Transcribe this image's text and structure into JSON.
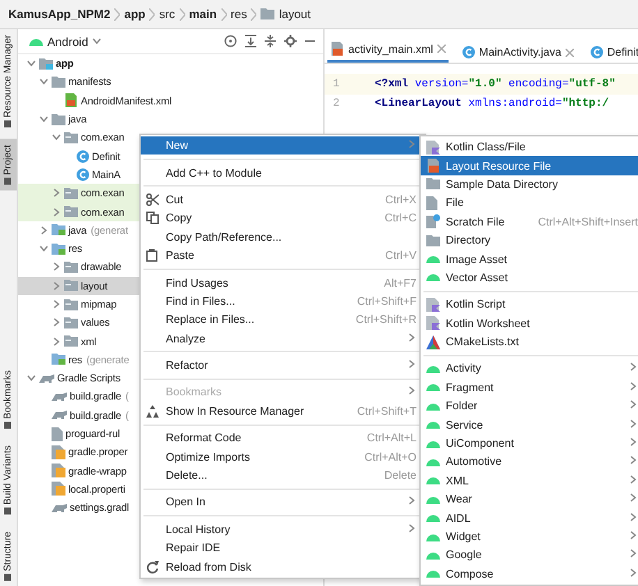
{
  "breadcrumb": [
    {
      "label": "KamusApp_NPM2",
      "bold": true,
      "kind": "plain"
    },
    {
      "label": "app",
      "bold": true,
      "kind": "plain"
    },
    {
      "label": "src",
      "bold": false,
      "kind": "plain"
    },
    {
      "label": "main",
      "bold": true,
      "kind": "plain"
    },
    {
      "label": "res",
      "bold": false,
      "kind": "plain"
    },
    {
      "label": "layout",
      "bold": false,
      "kind": "folder"
    }
  ],
  "tool_strip": {
    "top": [
      {
        "label": "Resource Manager",
        "selected": false
      },
      {
        "label": "Project",
        "selected": true
      }
    ],
    "bottom": [
      {
        "label": "Bookmarks",
        "selected": false
      },
      {
        "label": "Build Variants",
        "selected": false
      },
      {
        "label": "Structure",
        "selected": false
      }
    ]
  },
  "project_panel": {
    "view_selector": "Android",
    "tree": [
      {
        "label": "app",
        "kind": "module",
        "bold": true,
        "expanded": true,
        "selected": false,
        "test_source": false,
        "children": [
          {
            "label": "manifests",
            "kind": "folder",
            "expanded": true,
            "selected": false,
            "test_source": false,
            "children": [
              {
                "label": "AndroidManifest.xml",
                "kind": "manifest",
                "selected": false,
                "test_source": false
              }
            ]
          },
          {
            "label": "java",
            "kind": "folder",
            "expanded": true,
            "selected": false,
            "test_source": false,
            "children": [
              {
                "label": "com.exan",
                "kind": "package",
                "expanded": true,
                "selected": false,
                "test_source": false,
                "children": [
                  {
                    "label": "Definit",
                    "kind": "class",
                    "selected": false,
                    "test_source": false
                  },
                  {
                    "label": "MainA",
                    "kind": "class",
                    "selected": false,
                    "test_source": false
                  }
                ]
              },
              {
                "label": "com.exan",
                "kind": "package",
                "expanded": false,
                "selected": false,
                "test_source": true
              },
              {
                "label": "com.exan",
                "kind": "package",
                "expanded": false,
                "selected": false,
                "test_source": true
              }
            ]
          },
          {
            "label": "java",
            "note": "(generat",
            "kind": "generated",
            "expanded": false,
            "selected": false,
            "test_source": false
          },
          {
            "label": "res",
            "kind": "generated",
            "expanded": true,
            "selected": false,
            "test_source": false,
            "children": [
              {
                "label": "drawable",
                "kind": "package",
                "expanded": false,
                "selected": false,
                "test_source": false
              },
              {
                "label": "layout",
                "kind": "package",
                "expanded": false,
                "selected": true,
                "test_source": false
              },
              {
                "label": "mipmap",
                "kind": "package",
                "expanded": false,
                "selected": false,
                "test_source": false
              },
              {
                "label": "values",
                "kind": "package",
                "expanded": false,
                "selected": false,
                "test_source": false
              },
              {
                "label": "xml",
                "kind": "package",
                "expanded": false,
                "selected": false,
                "test_source": false
              }
            ]
          },
          {
            "label": "res",
            "note": "(generate",
            "kind": "generated",
            "selected": false,
            "test_source": false
          }
        ]
      },
      {
        "label": "Gradle Scripts",
        "kind": "gradle",
        "bold": false,
        "expanded": true,
        "selected": false,
        "test_source": false,
        "children": [
          {
            "label": "build.gradle",
            "note": "(",
            "kind": "gradle",
            "selected": false,
            "test_source": false
          },
          {
            "label": "build.gradle",
            "note": "(",
            "kind": "gradle",
            "selected": false,
            "test_source": false
          },
          {
            "label": "proguard-rul",
            "kind": "text-file",
            "selected": false,
            "test_source": false
          },
          {
            "label": "gradle.proper",
            "kind": "properties",
            "selected": false,
            "test_source": false
          },
          {
            "label": "gradle-wrapp",
            "kind": "properties",
            "selected": false,
            "test_source": false
          },
          {
            "label": "local.properti",
            "kind": "properties",
            "selected": false,
            "test_source": false
          },
          {
            "label": "settings.gradl",
            "kind": "gradle",
            "selected": false,
            "test_source": false
          }
        ]
      }
    ]
  },
  "editor": {
    "tabs": [
      {
        "label": "activity_main.xml",
        "kind": "layout-file",
        "closable": true,
        "selected": true
      },
      {
        "label": "MainActivity.java",
        "kind": "class",
        "closable": true,
        "selected": false
      },
      {
        "label": "Definit",
        "kind": "class",
        "closable": false,
        "selected": false
      }
    ],
    "lines": [
      {
        "number": "1",
        "current": true,
        "tokens": [
          {
            "kind": "tag",
            "text": "<?xml"
          },
          {
            "kind": "attr",
            "text": " version="
          },
          {
            "kind": "value",
            "text": "\"1.0\""
          },
          {
            "kind": "attr",
            "text": " encoding="
          },
          {
            "kind": "value",
            "text": "\"utf-8\""
          }
        ]
      },
      {
        "number": "2",
        "current": false,
        "tokens": [
          {
            "kind": "tag",
            "text": "<LinearLayout"
          },
          {
            "kind": "attr",
            "text": " xmlns:android="
          },
          {
            "kind": "value",
            "text": "\"http:/"
          }
        ]
      }
    ]
  },
  "context_menu": {
    "groups": [
      {
        "items": [
          {
            "label": "New",
            "kind": "plain",
            "submenu": true,
            "selected": true,
            "disabled": false
          }
        ]
      },
      {
        "items": [
          {
            "label": "Add C++ to Module",
            "kind": "plain",
            "submenu": false,
            "selected": false,
            "disabled": false
          }
        ]
      },
      {
        "items": [
          {
            "label": "Cut",
            "kind": "scissors",
            "shortcut": "Ctrl+X",
            "submenu": false,
            "selected": false,
            "disabled": false
          },
          {
            "label": "Copy",
            "kind": "copy",
            "shortcut": "Ctrl+C",
            "submenu": false,
            "selected": false,
            "disabled": false
          },
          {
            "label": "Copy Path/Reference...",
            "kind": "plain",
            "submenu": false,
            "selected": false,
            "disabled": false
          },
          {
            "label": "Paste",
            "kind": "clipboard",
            "shortcut": "Ctrl+V",
            "submenu": false,
            "selected": false,
            "disabled": false
          }
        ]
      },
      {
        "items": [
          {
            "label": "Find Usages",
            "kind": "plain",
            "shortcut": "Alt+F7",
            "submenu": false,
            "selected": false,
            "disabled": false
          },
          {
            "label": "Find in Files...",
            "kind": "plain",
            "shortcut": "Ctrl+Shift+F",
            "submenu": false,
            "selected": false,
            "disabled": false
          },
          {
            "label": "Replace in Files...",
            "kind": "plain",
            "shortcut": "Ctrl+Shift+R",
            "submenu": false,
            "selected": false,
            "disabled": false
          },
          {
            "label": "Analyze",
            "kind": "plain",
            "submenu": true,
            "selected": false,
            "disabled": false
          }
        ]
      },
      {
        "items": [
          {
            "label": "Refactor",
            "kind": "plain",
            "submenu": true,
            "selected": false,
            "disabled": false
          }
        ]
      },
      {
        "items": [
          {
            "label": "Bookmarks",
            "kind": "plain",
            "submenu": true,
            "selected": false,
            "disabled": true
          },
          {
            "label": "Show In Resource Manager",
            "kind": "resources",
            "shortcut": "Ctrl+Shift+T",
            "submenu": false,
            "selected": false,
            "disabled": false
          }
        ]
      },
      {
        "items": [
          {
            "label": "Reformat Code",
            "kind": "plain",
            "shortcut": "Ctrl+Alt+L",
            "submenu": false,
            "selected": false,
            "disabled": false
          },
          {
            "label": "Optimize Imports",
            "kind": "plain",
            "shortcut": "Ctrl+Alt+O",
            "submenu": false,
            "selected": false,
            "disabled": false
          },
          {
            "label": "Delete...",
            "kind": "plain",
            "shortcut": "Delete",
            "submenu": false,
            "selected": false,
            "disabled": false
          }
        ]
      },
      {
        "items": [
          {
            "label": "Open In",
            "kind": "plain",
            "submenu": true,
            "selected": false,
            "disabled": false
          }
        ]
      },
      {
        "items": [
          {
            "label": "Local History",
            "kind": "plain",
            "submenu": true,
            "selected": false,
            "disabled": false
          },
          {
            "label": "Repair IDE",
            "kind": "plain",
            "submenu": false,
            "selected": false,
            "disabled": false
          },
          {
            "label": "Reload from Disk",
            "kind": "reload",
            "submenu": false,
            "selected": false,
            "disabled": false
          }
        ]
      }
    ]
  },
  "new_submenu": {
    "groups": [
      {
        "items": [
          {
            "label": "Kotlin Class/File",
            "kind": "kotlin",
            "submenu": false,
            "selected": false
          },
          {
            "label": "Layout Resource File",
            "kind": "layout-file",
            "submenu": false,
            "selected": true
          },
          {
            "label": "Sample Data Directory",
            "kind": "folder",
            "submenu": false,
            "selected": false
          },
          {
            "label": "File",
            "kind": "file",
            "submenu": false,
            "selected": false
          },
          {
            "label": "Scratch File",
            "kind": "scratch",
            "shortcut": "Ctrl+Alt+Shift+Insert",
            "submenu": false,
            "selected": false
          },
          {
            "label": "Directory",
            "kind": "folder",
            "submenu": false,
            "selected": false
          },
          {
            "label": "Image Asset",
            "kind": "android",
            "submenu": false,
            "selected": false
          },
          {
            "label": "Vector Asset",
            "kind": "android",
            "submenu": false,
            "selected": false
          }
        ]
      },
      {
        "items": [
          {
            "label": "Kotlin Script",
            "kind": "kotlin",
            "submenu": false,
            "selected": false
          },
          {
            "label": "Kotlin Worksheet",
            "kind": "kotlin",
            "submenu": false,
            "selected": false
          },
          {
            "label": "CMakeLists.txt",
            "kind": "cmake",
            "submenu": false,
            "selected": false
          }
        ]
      },
      {
        "items": [
          {
            "label": "Activity",
            "kind": "android",
            "submenu": true,
            "selected": false
          },
          {
            "label": "Fragment",
            "kind": "android",
            "submenu": true,
            "selected": false
          },
          {
            "label": "Folder",
            "kind": "android",
            "submenu": true,
            "selected": false
          },
          {
            "label": "Service",
            "kind": "android",
            "submenu": true,
            "selected": false
          },
          {
            "label": "UiComponent",
            "kind": "android",
            "submenu": true,
            "selected": false
          },
          {
            "label": "Automotive",
            "kind": "android",
            "submenu": true,
            "selected": false
          },
          {
            "label": "XML",
            "kind": "android",
            "submenu": true,
            "selected": false
          },
          {
            "label": "Wear",
            "kind": "android",
            "submenu": true,
            "selected": false
          },
          {
            "label": "AIDL",
            "kind": "android",
            "submenu": true,
            "selected": false
          },
          {
            "label": "Widget",
            "kind": "android",
            "submenu": true,
            "selected": false
          },
          {
            "label": "Google",
            "kind": "android",
            "submenu": true,
            "selected": false
          },
          {
            "label": "Compose",
            "kind": "android",
            "submenu": true,
            "selected": false
          }
        ]
      }
    ]
  }
}
